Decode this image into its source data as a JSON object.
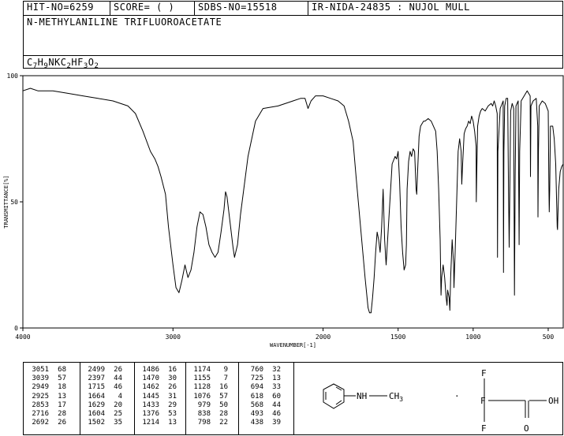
{
  "header": {
    "hit": "HIT-NO=6259",
    "score": "SCORE=  (   )",
    "sdbs": "SDBS-NO=15518",
    "ir": "IR-NIDA-24835 : NUJOL MULL",
    "compound_name": "N-METHYLANILINE TRIFLUOROACETATE",
    "formula": {
      "parts": [
        {
          "t": "C",
          "s": false
        },
        {
          "t": "7",
          "s": true
        },
        {
          "t": "H",
          "s": false
        },
        {
          "t": "9",
          "s": true
        },
        {
          "t": "NKC",
          "s": false
        },
        {
          "t": "2",
          "s": true
        },
        {
          "t": "HF",
          "s": false
        },
        {
          "t": "3",
          "s": true
        },
        {
          "t": "O",
          "s": false
        },
        {
          "t": "2",
          "s": true
        }
      ]
    }
  },
  "chart_data": {
    "type": "line",
    "xlabel": "WAVENUMBER[-1]",
    "ylabel": "TRANSMITTANCE[%]",
    "xlim": [
      4000,
      400
    ],
    "ylim": [
      0,
      100
    ],
    "x_ticks": [
      "4000",
      "3000",
      "2000",
      "1500",
      "1000",
      "500"
    ],
    "y_ticks": [
      "100",
      "50",
      "0"
    ],
    "series": [
      {
        "points": [
          [
            4000,
            94
          ],
          [
            3950,
            95
          ],
          [
            3900,
            94
          ],
          [
            3800,
            94
          ],
          [
            3700,
            93
          ],
          [
            3600,
            92
          ],
          [
            3500,
            91
          ],
          [
            3400,
            90
          ],
          [
            3300,
            88
          ],
          [
            3250,
            85
          ],
          [
            3200,
            78
          ],
          [
            3150,
            70
          ],
          [
            3120,
            67
          ],
          [
            3100,
            64
          ],
          [
            3080,
            60
          ],
          [
            3050,
            53
          ],
          [
            3030,
            40
          ],
          [
            3000,
            25
          ],
          [
            2980,
            16
          ],
          [
            2960,
            14
          ],
          [
            2940,
            19
          ],
          [
            2920,
            25
          ],
          [
            2900,
            20
          ],
          [
            2880,
            23
          ],
          [
            2860,
            30
          ],
          [
            2840,
            40
          ],
          [
            2820,
            46
          ],
          [
            2800,
            45
          ],
          [
            2780,
            40
          ],
          [
            2760,
            33
          ],
          [
            2740,
            30
          ],
          [
            2720,
            28
          ],
          [
            2700,
            30
          ],
          [
            2680,
            38
          ],
          [
            2660,
            47
          ],
          [
            2650,
            54
          ],
          [
            2640,
            52
          ],
          [
            2620,
            42
          ],
          [
            2600,
            32
          ],
          [
            2590,
            28
          ],
          [
            2570,
            33
          ],
          [
            2550,
            45
          ],
          [
            2500,
            68
          ],
          [
            2450,
            82
          ],
          [
            2400,
            87
          ],
          [
            2300,
            88
          ],
          [
            2200,
            90
          ],
          [
            2150,
            91
          ],
          [
            2120,
            91
          ],
          [
            2100,
            87
          ],
          [
            2080,
            90
          ],
          [
            2050,
            92
          ],
          [
            2000,
            92
          ],
          [
            1950,
            91
          ],
          [
            1900,
            90
          ],
          [
            1860,
            88
          ],
          [
            1830,
            82
          ],
          [
            1800,
            74
          ],
          [
            1780,
            60
          ],
          [
            1750,
            40
          ],
          [
            1720,
            20
          ],
          [
            1700,
            8
          ],
          [
            1690,
            6
          ],
          [
            1680,
            6
          ],
          [
            1670,
            12
          ],
          [
            1660,
            20
          ],
          [
            1650,
            30
          ],
          [
            1640,
            38
          ],
          [
            1630,
            35
          ],
          [
            1620,
            30
          ],
          [
            1610,
            40
          ],
          [
            1600,
            55
          ],
          [
            1590,
            35
          ],
          [
            1580,
            25
          ],
          [
            1560,
            45
          ],
          [
            1540,
            65
          ],
          [
            1520,
            68
          ],
          [
            1510,
            67
          ],
          [
            1500,
            70
          ],
          [
            1490,
            58
          ],
          [
            1480,
            40
          ],
          [
            1470,
            30
          ],
          [
            1460,
            23
          ],
          [
            1450,
            25
          ],
          [
            1445,
            33
          ],
          [
            1440,
            55
          ],
          [
            1430,
            66
          ],
          [
            1420,
            70
          ],
          [
            1410,
            68
          ],
          [
            1400,
            71
          ],
          [
            1390,
            70
          ],
          [
            1380,
            55
          ],
          [
            1376,
            53
          ],
          [
            1370,
            62
          ],
          [
            1360,
            76
          ],
          [
            1350,
            80
          ],
          [
            1340,
            81
          ],
          [
            1330,
            82
          ],
          [
            1320,
            82
          ],
          [
            1300,
            83
          ],
          [
            1280,
            82
          ],
          [
            1250,
            78
          ],
          [
            1240,
            70
          ],
          [
            1230,
            55
          ],
          [
            1220,
            35
          ],
          [
            1214,
            13
          ],
          [
            1210,
            20
          ],
          [
            1200,
            25
          ],
          [
            1190,
            20
          ],
          [
            1180,
            12
          ],
          [
            1174,
            9
          ],
          [
            1170,
            15
          ],
          [
            1160,
            12
          ],
          [
            1155,
            7
          ],
          [
            1150,
            20
          ],
          [
            1140,
            35
          ],
          [
            1130,
            25
          ],
          [
            1128,
            16
          ],
          [
            1120,
            30
          ],
          [
            1110,
            50
          ],
          [
            1100,
            70
          ],
          [
            1090,
            75
          ],
          [
            1080,
            70
          ],
          [
            1076,
            57
          ],
          [
            1070,
            65
          ],
          [
            1060,
            77
          ],
          [
            1050,
            79
          ],
          [
            1040,
            80
          ],
          [
            1030,
            82
          ],
          [
            1020,
            81
          ],
          [
            1010,
            84
          ],
          [
            1000,
            82
          ],
          [
            990,
            78
          ],
          [
            980,
            72
          ],
          [
            979,
            50
          ],
          [
            975,
            65
          ],
          [
            970,
            80
          ],
          [
            960,
            84
          ],
          [
            950,
            86
          ],
          [
            940,
            87
          ],
          [
            920,
            86
          ],
          [
            900,
            88
          ],
          [
            880,
            89
          ],
          [
            870,
            88
          ],
          [
            860,
            90
          ],
          [
            850,
            88
          ],
          [
            840,
            85
          ],
          [
            838,
            28
          ],
          [
            835,
            70
          ],
          [
            820,
            87
          ],
          [
            800,
            90
          ],
          [
            798,
            22
          ],
          [
            795,
            70
          ],
          [
            790,
            88
          ],
          [
            780,
            91
          ],
          [
            770,
            91
          ],
          [
            765,
            60
          ],
          [
            760,
            32
          ],
          [
            755,
            60
          ],
          [
            750,
            86
          ],
          [
            740,
            89
          ],
          [
            730,
            87
          ],
          [
            725,
            13
          ],
          [
            720,
            60
          ],
          [
            715,
            88
          ],
          [
            700,
            90
          ],
          [
            694,
            33
          ],
          [
            690,
            70
          ],
          [
            680,
            90
          ],
          [
            660,
            92
          ],
          [
            640,
            94
          ],
          [
            620,
            92
          ],
          [
            618,
            60
          ],
          [
            615,
            88
          ],
          [
            600,
            90
          ],
          [
            580,
            91
          ],
          [
            570,
            80
          ],
          [
            568,
            44
          ],
          [
            565,
            70
          ],
          [
            560,
            88
          ],
          [
            540,
            90
          ],
          [
            520,
            89
          ],
          [
            500,
            86
          ],
          [
            495,
            55
          ],
          [
            493,
            46
          ],
          [
            490,
            55
          ],
          [
            485,
            80
          ],
          [
            470,
            80
          ],
          [
            460,
            75
          ],
          [
            450,
            65
          ],
          [
            440,
            40
          ],
          [
            438,
            39
          ],
          [
            435,
            45
          ],
          [
            430,
            55
          ],
          [
            420,
            62
          ],
          [
            410,
            64
          ],
          [
            400,
            65
          ]
        ]
      }
    ]
  },
  "peaks": [
    [
      [
        "3051",
        "68"
      ],
      [
        "3039",
        "57"
      ],
      [
        "2949",
        "18"
      ],
      [
        "2925",
        "13"
      ],
      [
        "2853",
        "17"
      ],
      [
        "2716",
        "28"
      ],
      [
        "2692",
        "26"
      ]
    ],
    [
      [
        "2499",
        "26"
      ],
      [
        "2397",
        "44"
      ],
      [
        "1715",
        "46"
      ],
      [
        "1664",
        "4"
      ],
      [
        "1629",
        "20"
      ],
      [
        "1604",
        "25"
      ],
      [
        "1502",
        "35"
      ]
    ],
    [
      [
        "1486",
        "16"
      ],
      [
        "1470",
        "30"
      ],
      [
        "1462",
        "26"
      ],
      [
        "1445",
        "31"
      ],
      [
        "1433",
        "29"
      ],
      [
        "1376",
        "53"
      ],
      [
        "1214",
        "13"
      ]
    ],
    [
      [
        "1174",
        "9"
      ],
      [
        "1155",
        "7"
      ],
      [
        "1128",
        "16"
      ],
      [
        "1076",
        "57"
      ],
      [
        "979",
        "50"
      ],
      [
        "838",
        "28"
      ],
      [
        "798",
        "22"
      ]
    ],
    [
      [
        "760",
        "32"
      ],
      [
        "725",
        "13"
      ],
      [
        "694",
        "33"
      ],
      [
        "618",
        "60"
      ],
      [
        "568",
        "44"
      ],
      [
        "493",
        "46"
      ],
      [
        "438",
        "39"
      ]
    ]
  ],
  "structure": {
    "nh": "NH",
    "ch3": "CH3",
    "dot": "·",
    "f_top": "F",
    "f_left": "F",
    "f_bottom": "F",
    "c1": "C",
    "c2": "C",
    "o": "O",
    "oh": "OH"
  }
}
